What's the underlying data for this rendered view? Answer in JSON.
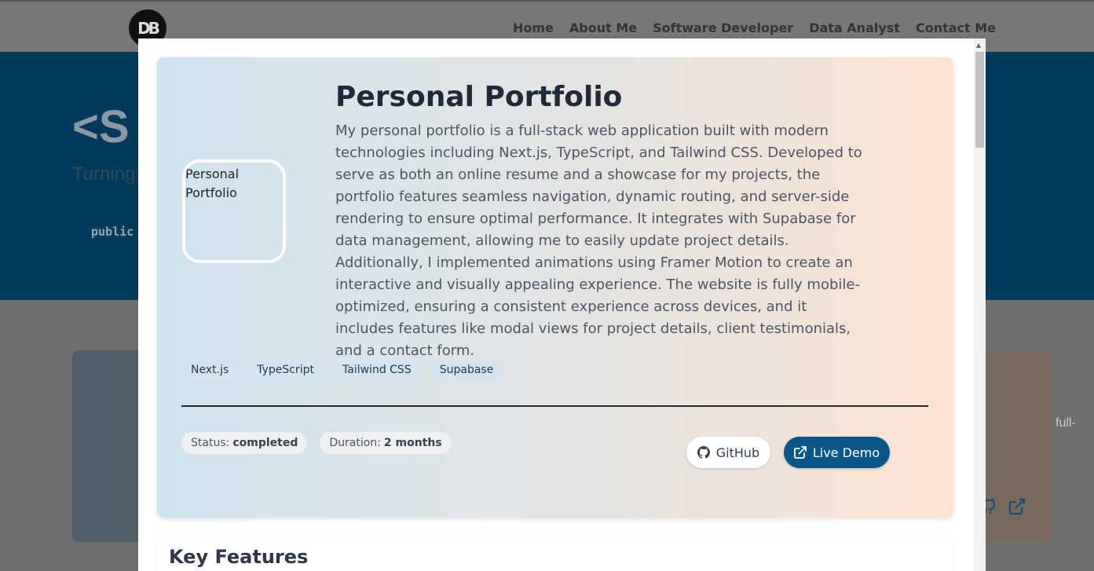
{
  "background": {
    "logo_text": "DB",
    "nav": [
      "Home",
      "About Me",
      "Software Developer",
      "Data Analyst",
      "Contact Me"
    ],
    "hero_title_fragment": "<S",
    "hero_subtitle_fragment": "Turning",
    "hero_code_fragment": "public",
    "card_text_fragment": "full-"
  },
  "modal": {
    "project": {
      "image_alt": "Personal Portfolio",
      "title": "Personal Portfolio",
      "description": "My personal portfolio is a full-stack web application built with modern technologies including Next.js, TypeScript, and Tailwind CSS. Developed to serve as both an online resume and a showcase for my projects, the portfolio features seamless navigation, dynamic routing, and server-side rendering to ensure optimal performance. It integrates with Supabase for data management, allowing me to easily update project details. Additionally, I implemented animations using Framer Motion to create an interactive and visually appealing experience. The website is fully mobile-optimized, ensuring a consistent experience across devices, and it includes features like modal views for project details, client testimonials, and a contact form.",
      "tags": [
        "Next.js",
        "TypeScript",
        "Tailwind CSS",
        "Supabase"
      ],
      "status_label": "Status:",
      "status_value": "completed",
      "duration_label": "Duration:",
      "duration_value": "2 months",
      "github_label": "GitHub",
      "live_demo_label": "Live Demo"
    },
    "features_title": "Key Features"
  },
  "colors": {
    "primary": "#08558a",
    "hero_bg": "#023a5c"
  },
  "icons": {
    "github": "github-icon",
    "external": "external-link-icon",
    "logo": "db-logo"
  }
}
